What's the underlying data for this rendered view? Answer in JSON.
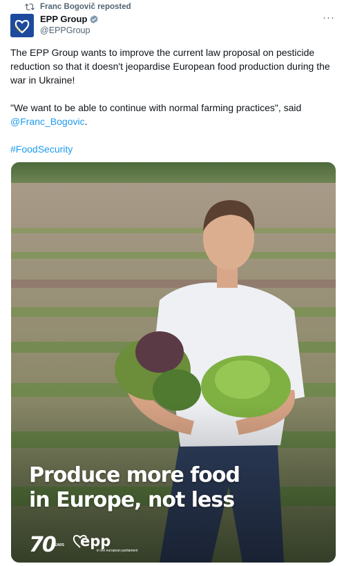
{
  "repost": {
    "icon": "repost-icon",
    "text": "Franc Bogovič reposted"
  },
  "author": {
    "name": "EPP Group",
    "handle": "@EPPGroup",
    "verified_icon": "verified-gray-badge-icon",
    "avatar_icon": "epp-heart-logo-icon"
  },
  "menu": {
    "icon": "more-options-icon",
    "label": "···"
  },
  "tweet": {
    "para1": "The EPP Group wants to improve the current law proposal on pesticide reduction so that it doesn't jeopardise European food production during the war in Ukraine!",
    "para2_text": "\"We want to be able to continue with normal farming practices\", said ",
    "para2_mention": "@Franc_Bogovic",
    "para2_end": ".",
    "hashtag": "#FoodSecurity"
  },
  "media": {
    "headline_line1": "Produce more food",
    "headline_line2": "in Europe, not less",
    "anniversary_number": "70",
    "anniversary_label": "YEARS",
    "logo_word": "epp",
    "logo_sub": "in the european parliament"
  },
  "colors": {
    "link": "#1d9bf0",
    "text": "#0f1419",
    "muted": "#536471",
    "avatar_bg": "#1d4a9c"
  }
}
